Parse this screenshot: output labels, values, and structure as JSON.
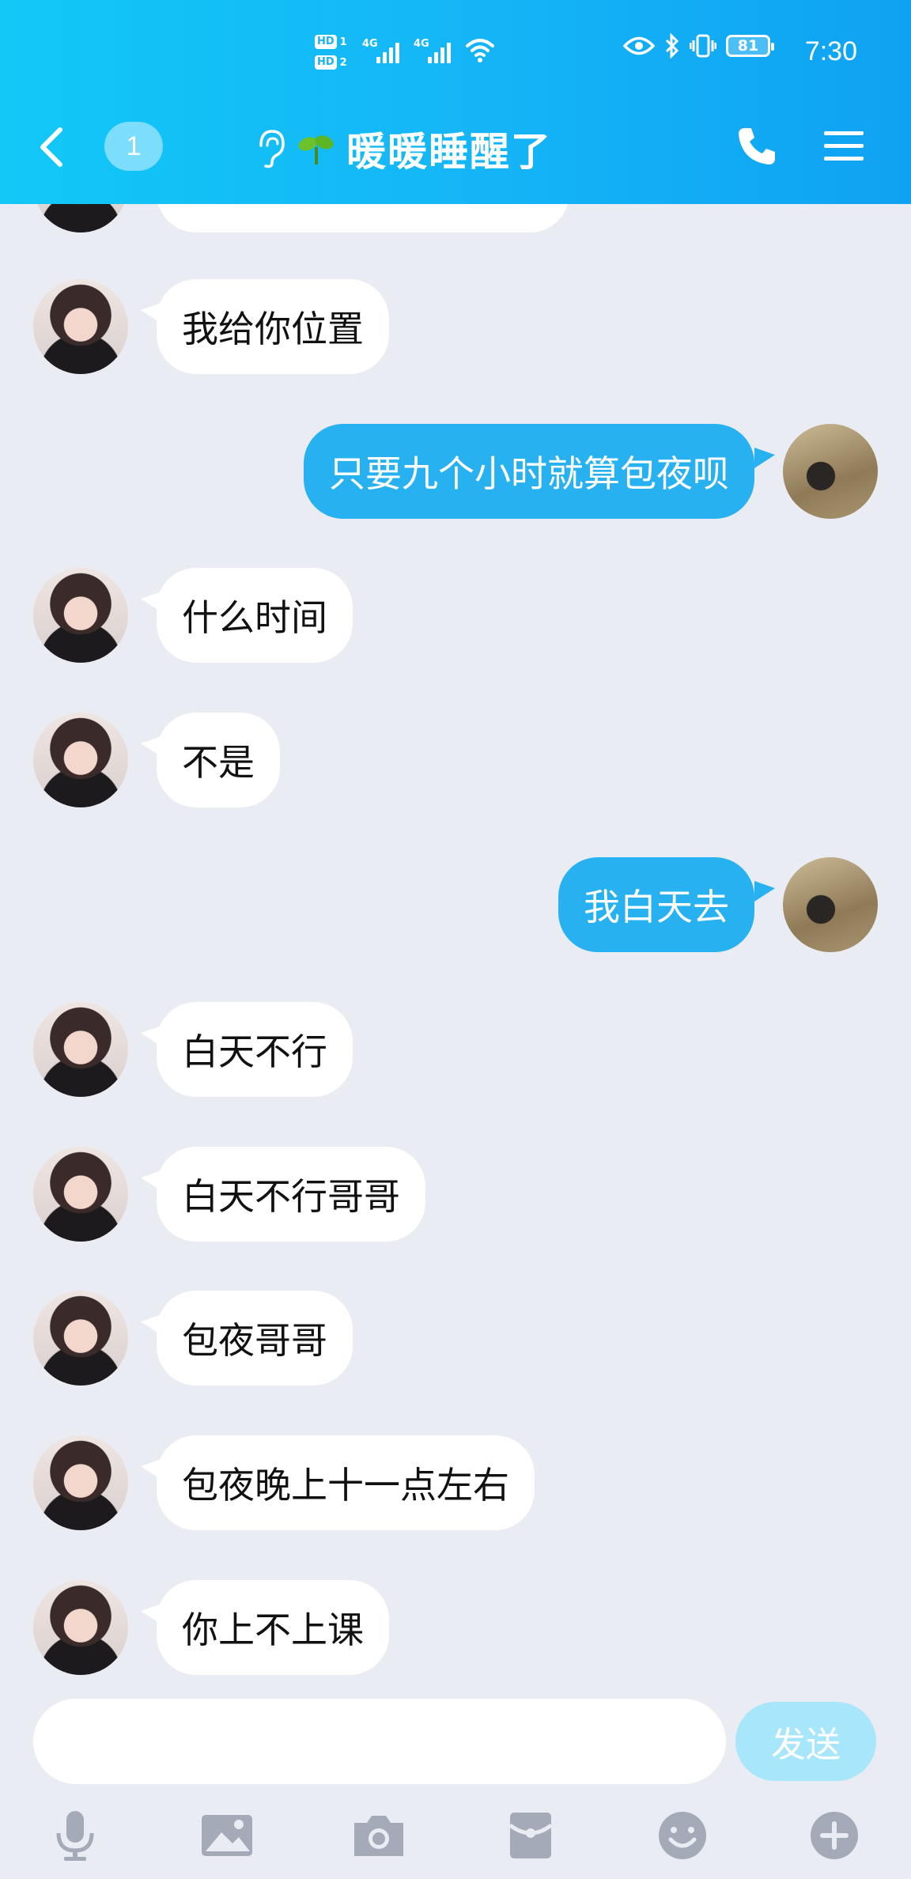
{
  "status_bar": {
    "sim1": "HD",
    "sim1_num": "1",
    "sim2": "HD",
    "sim2_num": "2",
    "network1": "4G",
    "network2": "4G",
    "battery": "81",
    "time": "7:30",
    "icons": [
      "eye-icon",
      "bluetooth-icon",
      "vibrate-icon",
      "wifi-icon",
      "battery-icon"
    ]
  },
  "header": {
    "unread_count": "1",
    "title": "暖暖睡醒了",
    "title_icons": [
      "ear-icon",
      "sprout-icon"
    ],
    "colors": {
      "from": "#12c8f7",
      "to": "#0fa2f2"
    }
  },
  "messages": [
    {
      "side": "in",
      "text": "我给你位置"
    },
    {
      "side": "out",
      "text": "只要九个小时就算包夜呗"
    },
    {
      "side": "in",
      "text": "什么时间"
    },
    {
      "side": "in",
      "text": "不是"
    },
    {
      "side": "out",
      "text": "我白天去"
    },
    {
      "side": "in",
      "text": "白天不行"
    },
    {
      "side": "in",
      "text": "白天不行哥哥"
    },
    {
      "side": "in",
      "text": "包夜哥哥"
    },
    {
      "side": "in",
      "text": "包夜晚上十一点左右"
    },
    {
      "side": "in",
      "text": "你上不上课"
    }
  ],
  "composer": {
    "value": "",
    "send_label": "发送",
    "tools": [
      "microphone-icon",
      "image-icon",
      "camera-icon",
      "red-packet-icon",
      "emoji-icon",
      "plus-icon"
    ]
  },
  "colors": {
    "background": "#eaecf3",
    "bubble_out": "#27b1f0",
    "bubble_in": "#ffffff",
    "send_disabled": "#a7e6fb"
  }
}
